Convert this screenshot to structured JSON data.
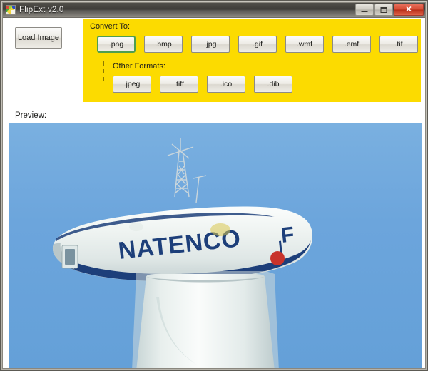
{
  "window": {
    "title": "FlipExt v2.0",
    "icon": "image-palette-icon",
    "controls": {
      "minimize_label": "Minimize",
      "maximize_label": "Maximize",
      "close_label": "✕"
    }
  },
  "toolbar": {
    "load_image_label": "Load Image"
  },
  "convert_panel": {
    "title": "Convert To:",
    "other_formats_label": "Other Formats:",
    "background_color": "#fcdb00",
    "selected_format": ".png",
    "selection_border_color": "#4f9e4f",
    "primary_formats": [
      {
        "label": ".png",
        "selected": true
      },
      {
        "label": ".bmp",
        "selected": false
      },
      {
        "label": ".jpg",
        "selected": false
      },
      {
        "label": ".gif",
        "selected": false
      },
      {
        "label": ".wmf",
        "selected": false
      },
      {
        "label": ".emf",
        "selected": false
      },
      {
        "label": ".tif",
        "selected": false
      }
    ],
    "other_formats": [
      {
        "label": ".jpeg",
        "selected": false
      },
      {
        "label": ".tiff",
        "selected": false
      },
      {
        "label": ".ico",
        "selected": false
      },
      {
        "label": ".dib",
        "selected": false
      }
    ]
  },
  "preview": {
    "label": "Preview:",
    "image_subject": "wind turbine nacelle against blue sky",
    "nacelle_text": "NATENCO",
    "logo_letter": "F",
    "sky_color": "#6aa3dc",
    "nacelle_color": "#eef2f0",
    "stripe_color": "#1d3f7a",
    "logo_dot_color": "#c8332b",
    "tower_color": "#f0f3f1"
  }
}
